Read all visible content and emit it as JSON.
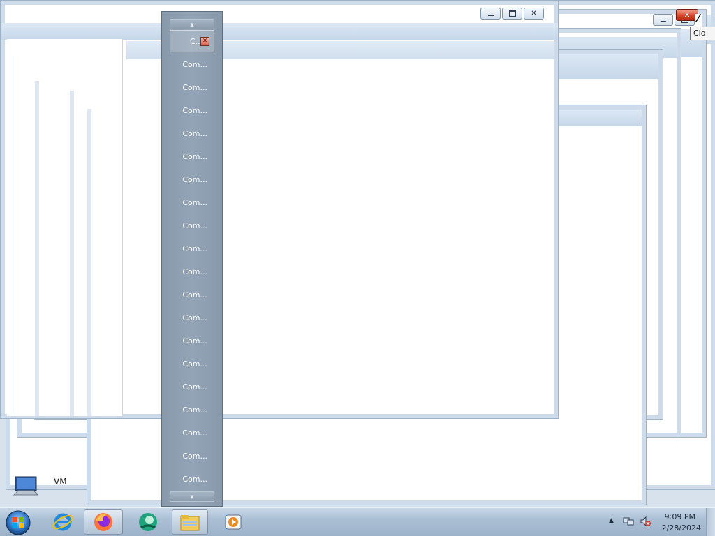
{
  "jumplist": {
    "items": [
      "C...",
      "Com...",
      "Com...",
      "Com...",
      "Com...",
      "Com...",
      "Com...",
      "Com...",
      "Com...",
      "Com...",
      "Com...",
      "Com...",
      "Com...",
      "Com...",
      "Com...",
      "Com...",
      "Com...",
      "Com...",
      "Com...",
      "Com..."
    ],
    "scroll_up_icon": "triangle-up-icon",
    "scroll_down_icon": "triangle-down-icon"
  },
  "tooltip": {
    "text": "Clo"
  },
  "desktop": {
    "icon_label": "VM"
  },
  "taskbar": {
    "pinned": [
      {
        "name": "internet-explorer-icon"
      },
      {
        "name": "firefox-icon"
      },
      {
        "name": "green-app-icon"
      },
      {
        "name": "file-explorer-icon"
      },
      {
        "name": "media-player-icon"
      }
    ],
    "clock_time": "9:09 PM",
    "clock_date": "2/28/2024"
  },
  "colors": {
    "accent_close": "#c8503c",
    "jumplist_bg": "#8899ab",
    "taskbar_bg": "#aabfd4"
  }
}
